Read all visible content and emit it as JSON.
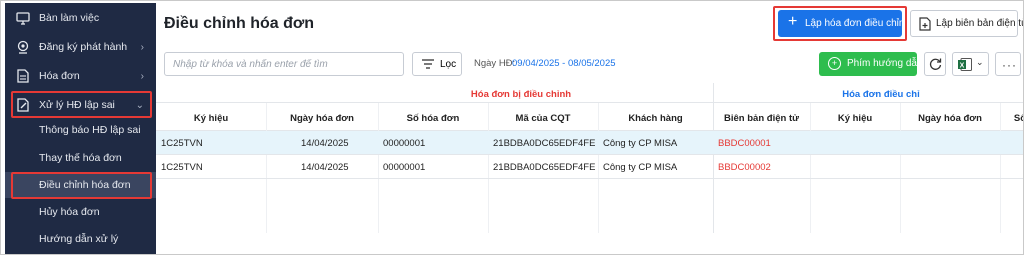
{
  "sidebar": {
    "items": [
      {
        "label": "Bàn làm việc"
      },
      {
        "label": "Đăng ký phát hành"
      },
      {
        "label": "Hóa đơn"
      },
      {
        "label": "Xử lý HĐ lập sai"
      }
    ],
    "sub_items": [
      {
        "label": "Thông báo HĐ lập sai"
      },
      {
        "label": "Thay thế hóa đơn"
      },
      {
        "label": "Điều chỉnh hóa đơn"
      },
      {
        "label": "Hủy hóa đơn"
      },
      {
        "label": "Hướng dẫn xử lý"
      }
    ]
  },
  "header": {
    "title": "Điều chỉnh hóa đơn",
    "primary_button": "Lập hóa đơn điều chỉnh",
    "secondary_button": "Lập biên bản điện tử"
  },
  "toolbar": {
    "search_placeholder": "Nhập từ khóa và nhấn enter để tìm",
    "filter_label": "Lọc",
    "date_label": "Ngày HĐ:",
    "date_value": "09/04/2025 - 08/05/2025",
    "hotkey_button": "Phím hướng dẫn"
  },
  "table": {
    "group_headers": [
      "Hóa đơn bị điều chỉnh",
      "Hóa đơn điều chỉ"
    ],
    "columns": [
      "Ký hiệu",
      "Ngày hóa đơn",
      "Số hóa đơn",
      "Mã của CQT",
      "Khách hàng",
      "Biên bản điện tử",
      "Ký hiệu",
      "Ngày hóa đơn",
      "Số"
    ],
    "rows": [
      [
        "1C25TVN",
        "14/04/2025",
        "00000001",
        "21BDBA0DC65EDF4FE6...",
        "Công ty CP MISA",
        "BBDC00001",
        "",
        "",
        ""
      ],
      [
        "1C25TVN",
        "14/04/2025",
        "00000001",
        "21BDBA0DC65EDF4FE6...",
        "Công ty CP MISA",
        "BBDC00002",
        "",
        "",
        ""
      ]
    ]
  },
  "colors": {
    "sidebar_bg": "#1f2a44",
    "primary": "#1a73e8",
    "green": "#2ebd4e",
    "highlight_red": "#e53935",
    "selected_row": "#e6f4fb"
  }
}
